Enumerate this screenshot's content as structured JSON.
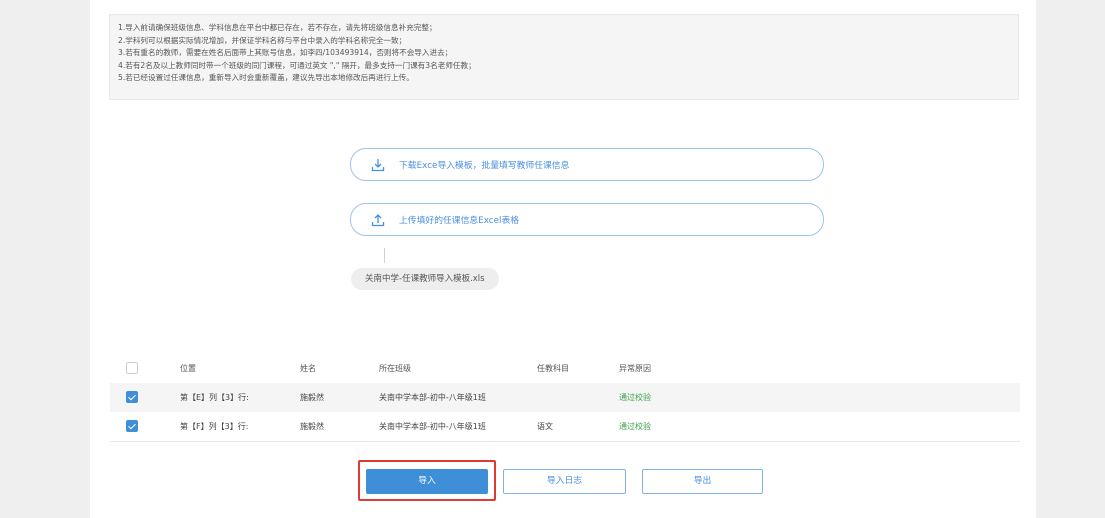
{
  "notes": [
    "1.导入前请确保班级信息、学科信息在平台中都已存在，若不存在，请先将班级信息补充完整；",
    "2.学科列可以根据实际情况增加，并保证学科名称与平台中录入的学科名称完全一致；",
    "3.若有重名的教师，需要在姓名后面带上其账号信息，如李四/103493914，否则将不会导入进去；",
    "4.若有2名及以上教师同时带一个班级的同门课程，可通过英文 \",\" 隔开，最多支持一门课有3名老师任教；",
    "5.若已经设置过任课信息，重新导入时会重新覆盖，建议先导出本地修改后再进行上传。"
  ],
  "actions": {
    "download_label": "下载Exce导入模板，批量填写教师任课信息",
    "upload_label": "上传填好的任课信息Excel表格",
    "uploaded_file": "关南中学-任课教师导入模板.xls"
  },
  "table": {
    "headers": {
      "position": "位置",
      "name": "姓名",
      "class": "所在班级",
      "subject": "任教科目",
      "error": "异常原因"
    },
    "rows": [
      {
        "checked": true,
        "position": "第【E】列【3】行:",
        "name": "施毅然",
        "class": "关南中学本部-初中-八年级1班",
        "subject": "",
        "error": "通过校验"
      },
      {
        "checked": true,
        "position": "第【F】列【3】行:",
        "name": "施毅然",
        "class": "关南中学本部-初中-八年级1班",
        "subject": "语文",
        "error": "通过校验"
      }
    ]
  },
  "buttons": {
    "import": "导入",
    "import_log": "导入日志",
    "export": "导出"
  },
  "colors": {
    "accent": "#3e8ed8",
    "success": "#3aa14a",
    "highlight": "#e03a32"
  }
}
